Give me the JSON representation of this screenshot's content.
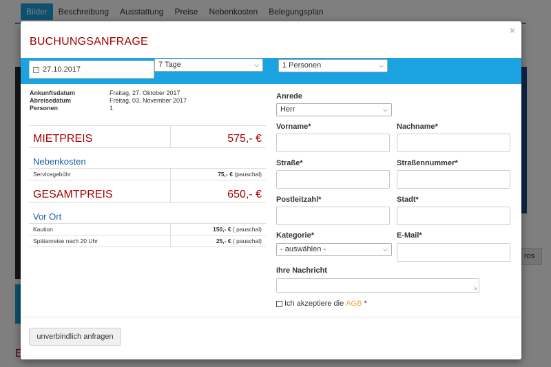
{
  "background": {
    "nav": [
      "Bilder",
      "Beschreibung",
      "Ausstattung",
      "Preise",
      "Nebenkosten",
      "Belegungsplan"
    ],
    "partial_button": "ros",
    "partial_heading": "E"
  },
  "modal": {
    "title": "BUCHUNGSANFRAGE",
    "close": "×",
    "date": "27.10.2017",
    "days": "7 Tage",
    "persons": "1 Personen"
  },
  "summary": {
    "rows": [
      {
        "label": "Ankunftsdatum",
        "value": "Freitag, 27. Oktober 2017"
      },
      {
        "label": "Abreisedatum",
        "value": "Freitag, 03. November 2017"
      },
      {
        "label": "Personen",
        "value": "1"
      }
    ]
  },
  "prices": {
    "rent_label": "MIETPREIS",
    "rent_value": "575,- €",
    "extras_heading": "Nebenkosten",
    "service_label": "Servicegebühr",
    "service_amount": "75,- €",
    "service_note": "(pauschal)",
    "total_label": "GESAMTPREIS",
    "total_value": "650,- €",
    "onsite_heading": "Vor Ort",
    "deposit_label": "Kaution",
    "deposit_amount": "150,- €",
    "deposit_note": "( pauschal)",
    "late_label": "Spätanreise nach 20 Uhr",
    "late_amount": "25,- €",
    "late_note": "( pauschal)"
  },
  "form": {
    "salutation_label": "Anrede",
    "salutation_value": "Herr",
    "firstname_label": "Vorname*",
    "lastname_label": "Nachname*",
    "street_label": "Straße*",
    "housenumber_label": "Straßennummer*",
    "zip_label": "Postleitzahl*",
    "city_label": "Stadt*",
    "category_label": "Kategorie*",
    "category_value": "- auswählen -",
    "email_label": "E-Mail*",
    "message_label": "Ihre Nachricht",
    "agb_text": "Ich akzeptiere die",
    "agb_link": "AGB",
    "agb_star": "*"
  },
  "footer": {
    "submit_label": "unverbindlich anfragen"
  },
  "colors": {
    "accent_blue": "#1aa3e0",
    "title_red": "#a40000",
    "heading_blue": "#1c5ca8",
    "link_orange": "#e8a43a"
  }
}
